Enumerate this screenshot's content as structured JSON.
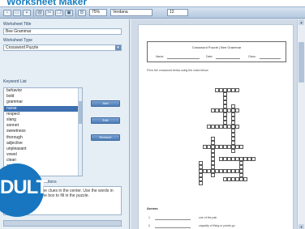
{
  "page_title": "Worksheet Maker",
  "toolbar": {
    "buttons": [
      "new-icon",
      "open-icon",
      "save-icon",
      "print-icon",
      "cut-icon",
      "copy-icon",
      "paste-icon"
    ],
    "zoom": "75%",
    "font": "Verdana",
    "size": "12"
  },
  "form": {
    "title_label": "Worksheet Title",
    "title_value": "Bee Grammar",
    "type_label": "Worksheet Type",
    "type_value": "Crossword Puzzle",
    "keywords_label": "Keyword List",
    "keywords": [
      "behavior",
      "bold",
      "grammar",
      "nurse",
      "respect",
      "slang",
      "sonnet",
      "sweetness",
      "thorough",
      "adjective",
      "unpleasant",
      "vowel",
      "clean",
      "accept",
      "creative"
    ],
    "selected_keyword_index": 3,
    "add_label": "Add",
    "edit_label": "Edit",
    "remove_label": "Remove",
    "instructions_label": "Instructions",
    "instructions_text": "the clues in the center. Use the words in the box to fill in the puzzle.",
    "generate_label": ""
  },
  "badge": {
    "text": "DULT",
    "color": "#1776bf"
  },
  "preview": {
    "doc_title": "Crossword Puzzle | Bee Grammar",
    "name_label": "Name:",
    "date_label": "Date:",
    "class_label": "Class:",
    "instructions": "Fill in the crossword below using the clues below.",
    "clues_heading": "Across",
    "clues": [
      {
        "number": "1.",
        "text": "one of the pair"
      },
      {
        "number": "2.",
        "text": "capacity of thing or points go"
      }
    ]
  },
  "colors": {
    "accent": "#1a7fc1",
    "selection": "#3d6fb0",
    "panel": "#e5edf5"
  }
}
